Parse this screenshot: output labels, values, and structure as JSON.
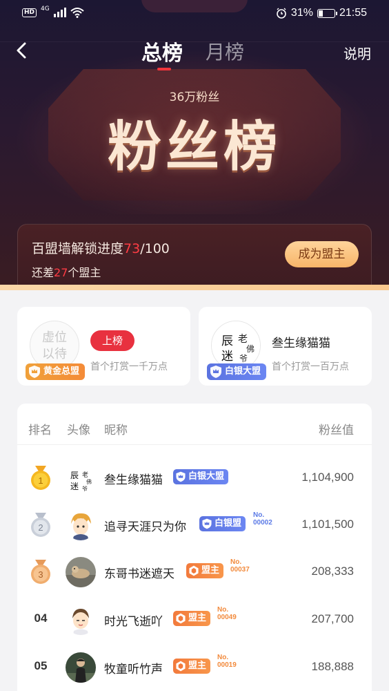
{
  "status_bar": {
    "hd": "HD",
    "network": "4G",
    "battery_percent": "31%",
    "battery_level": 0.31,
    "time": "21:55"
  },
  "nav": {
    "tabs": [
      {
        "label": "总榜",
        "active": true
      },
      {
        "label": "月榜",
        "active": false
      }
    ],
    "explain": "说明"
  },
  "hero": {
    "subtitle": "36万粉丝",
    "title": "粉丝榜"
  },
  "unlock": {
    "label": "百盟墙解锁进度",
    "current": "73",
    "total": "/100",
    "remain_prefix": "还差",
    "remain_count": "27",
    "remain_suffix": "个盟主",
    "button": "成为盟主"
  },
  "top_cards": [
    {
      "placeholder": "虚位\n以待",
      "badge": "黄金总盟",
      "pill": "上榜",
      "hint": "首个打赏一千万点"
    },
    {
      "name": "叁生缘猫猫",
      "badge": "白银大盟",
      "hint": "首个打赏一百万点"
    }
  ],
  "ranking": {
    "headers": {
      "rank": "排名",
      "avatar": "头像",
      "nickname": "昵称",
      "value": "粉丝值"
    },
    "rows": [
      {
        "rank": "1",
        "name": "叁生缘猫猫",
        "tag": "白银大盟",
        "tag_type": "silver",
        "no": "",
        "value": "1,104,900"
      },
      {
        "rank": "2",
        "name": "追寻天涯只为你",
        "tag": "白银盟",
        "tag_type": "silver",
        "no": "00002",
        "value": "1,101,500"
      },
      {
        "rank": "3",
        "name": "东哥书迷遮天",
        "tag": "盟主",
        "tag_type": "orange",
        "no": "00037",
        "value": "208,333"
      },
      {
        "rank": "04",
        "name": "时光飞逝吖",
        "tag": "盟主",
        "tag_type": "orange",
        "no": "00049",
        "value": "207,700"
      },
      {
        "rank": "05",
        "name": "牧童听竹声",
        "tag": "盟主",
        "tag_type": "orange",
        "no": "00019",
        "value": "188,888"
      }
    ],
    "no_prefix": "No."
  },
  "colors": {
    "accent_red": "#e8313f",
    "gold": "#f0a13a",
    "silver_blue": "#5b73e0",
    "orange": "#f27a3c"
  }
}
